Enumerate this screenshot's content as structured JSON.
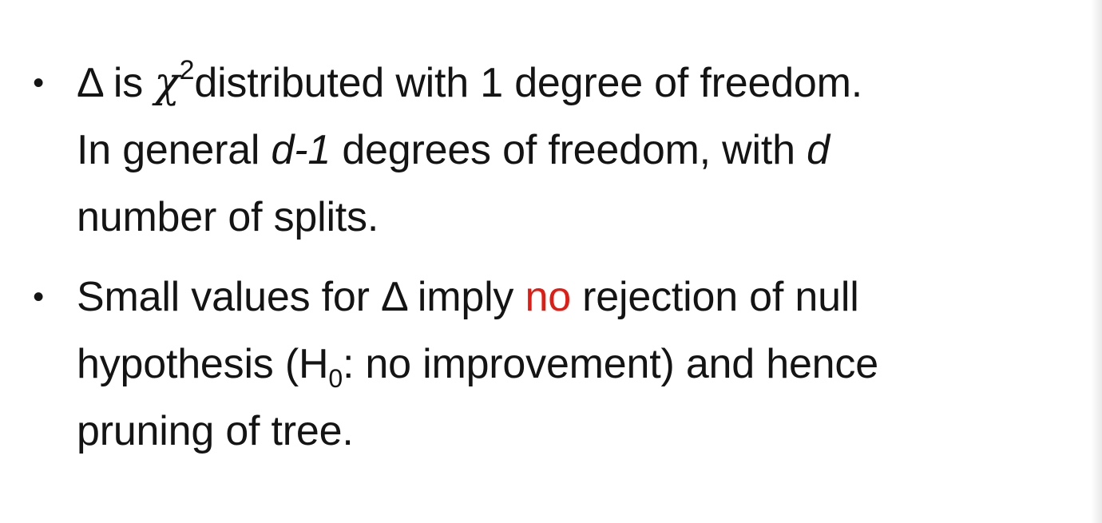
{
  "bullets": [
    {
      "marker": "•",
      "lines": [
        {
          "delta": "Δ",
          "is": " is ",
          "chi": "χ",
          "chi_exp": "2",
          "rest": "distributed with 1 degree of freedom."
        },
        {
          "pre": "In general ",
          "d_minus_1": "d-1",
          "mid": " degrees of freedom, with ",
          "d": "d"
        },
        {
          "text": "number of splits."
        }
      ]
    },
    {
      "marker": "•",
      "lines": [
        {
          "pre": "Small values for ",
          "delta": "Δ",
          "mid": " imply ",
          "emphasis": "no",
          "post": " rejection of null"
        },
        {
          "pre": "hypothesis (H",
          "sub": "0",
          "post": ": no improvement) and hence"
        },
        {
          "text": "pruning of tree."
        }
      ]
    }
  ],
  "colors": {
    "text": "#141414",
    "emphasis": "#e31b12",
    "background": "#ffffff"
  }
}
